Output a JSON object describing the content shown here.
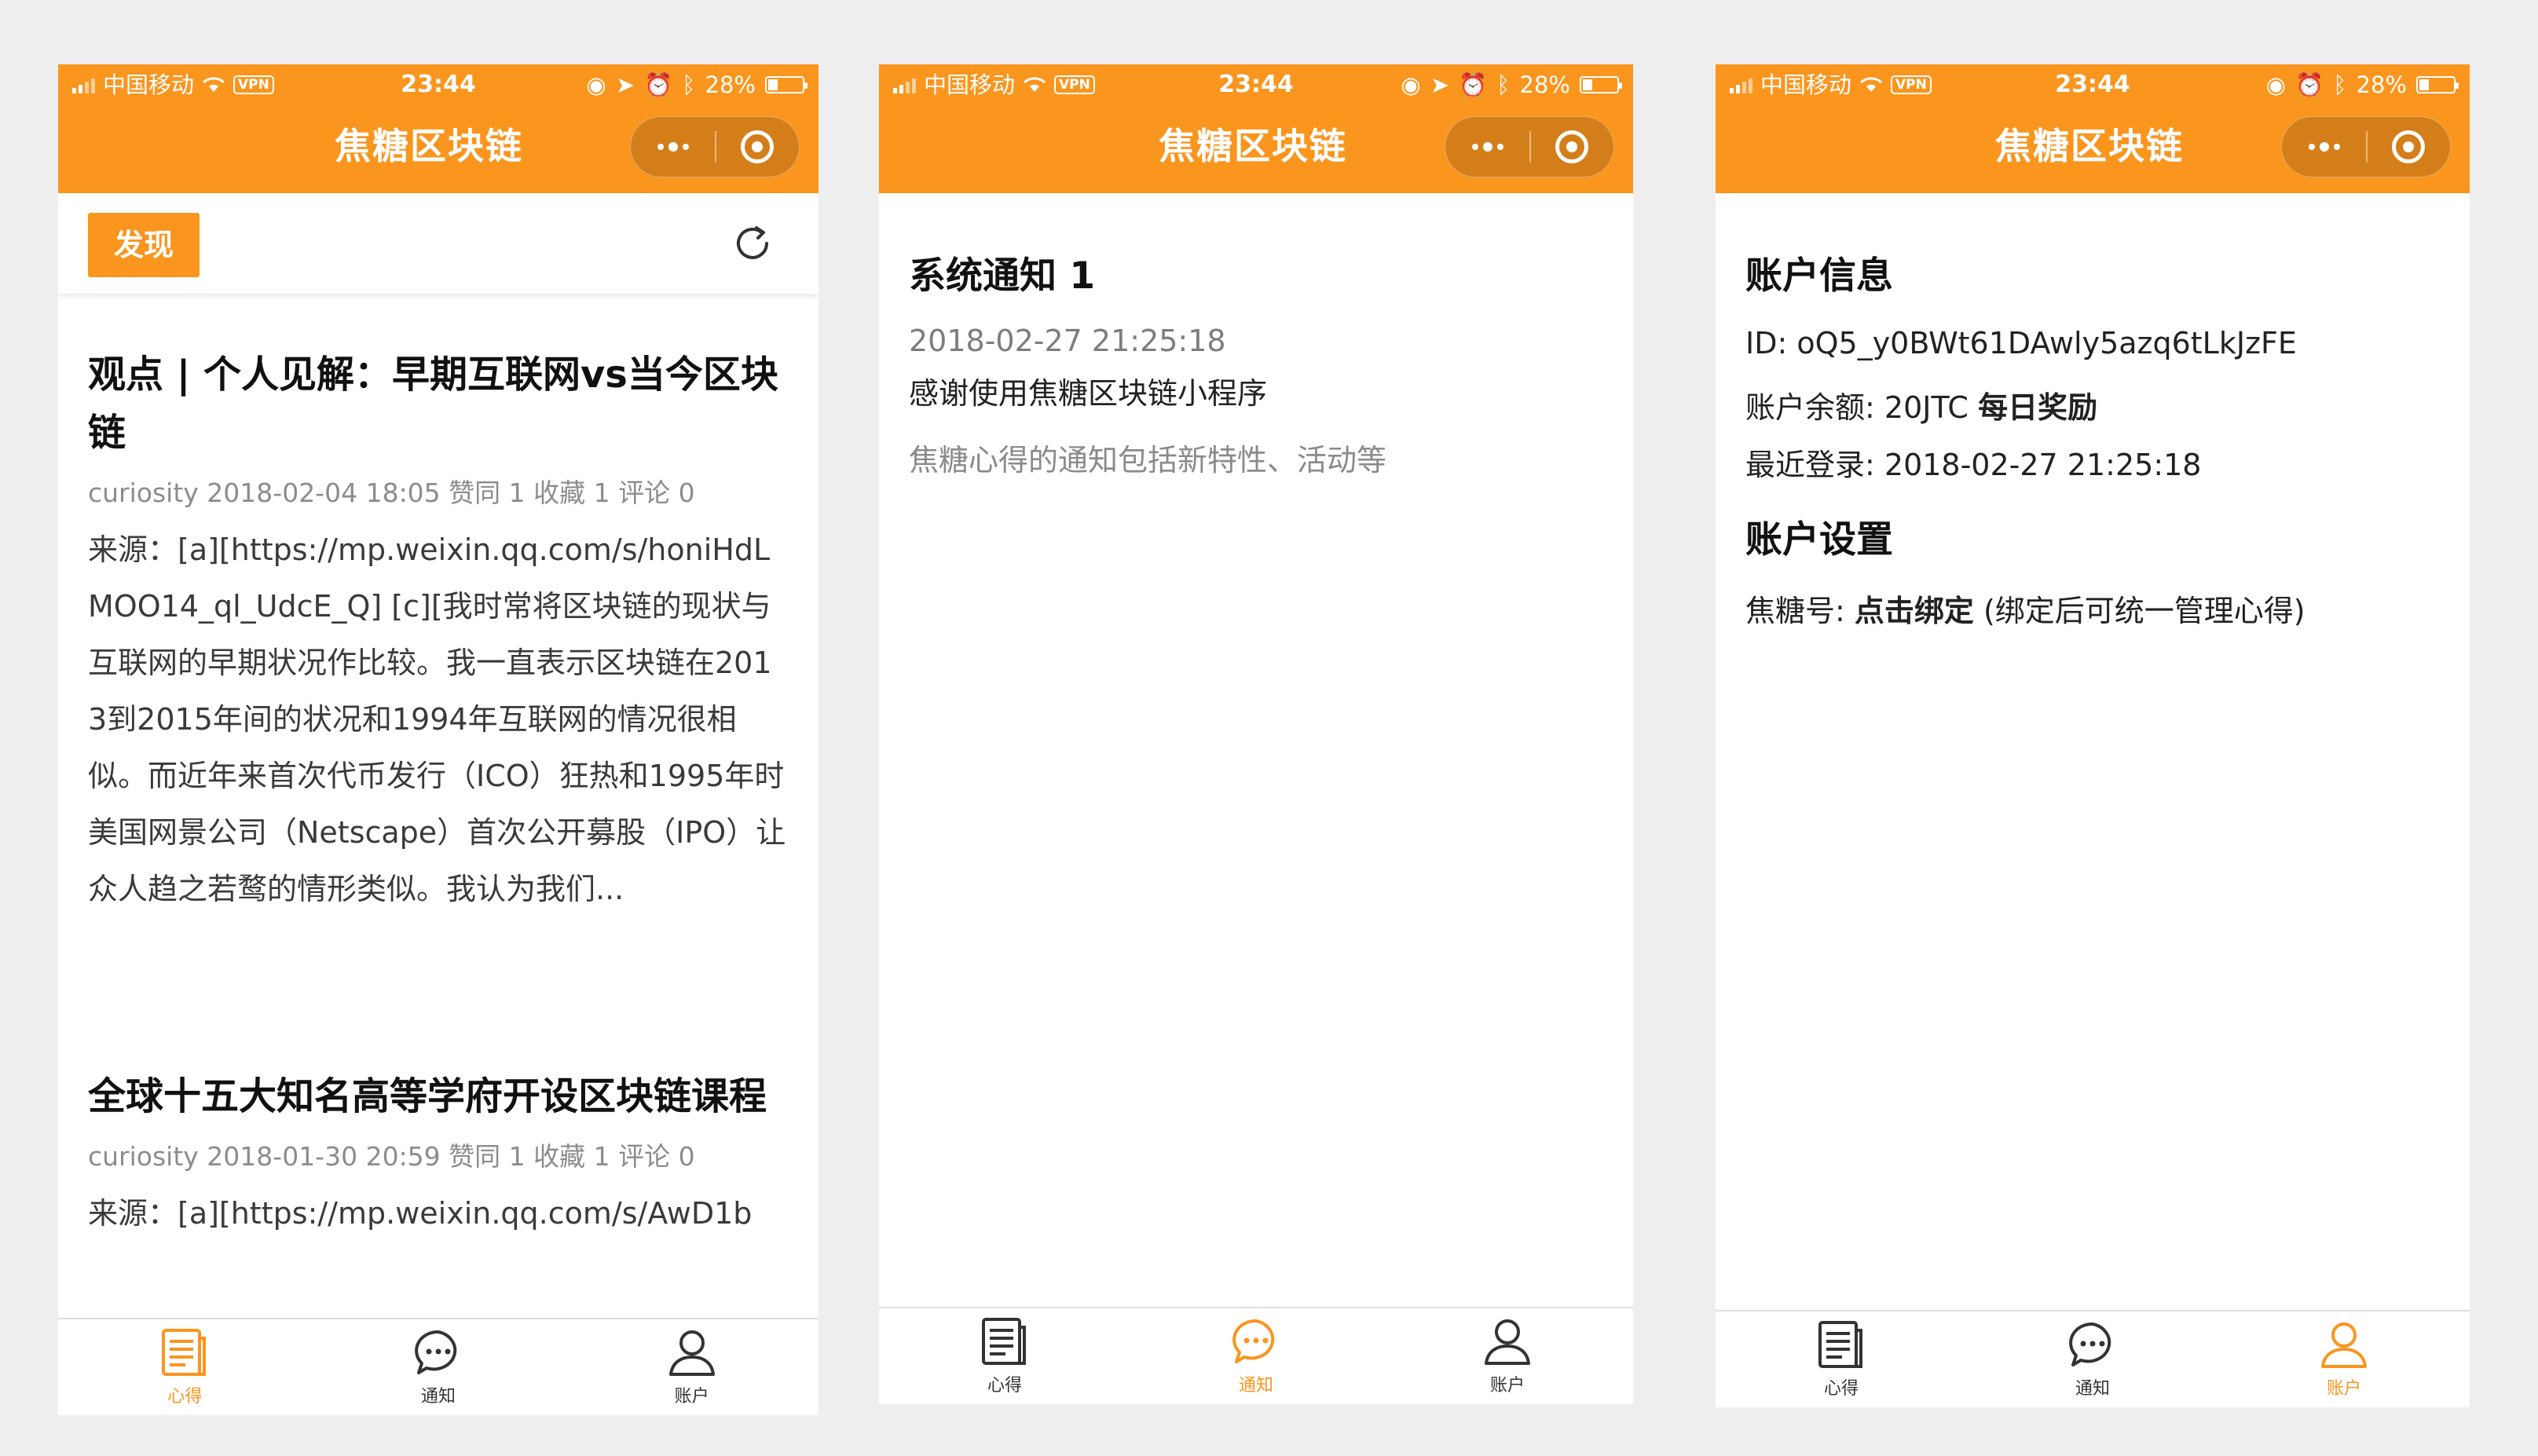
{
  "status": {
    "carrier": "中国移动",
    "vpn": "VPN",
    "time": "23:44",
    "battery": "28%"
  },
  "nav": {
    "title": "焦糖区块链"
  },
  "tabs": [
    {
      "label": "心得",
      "icon": "document-icon"
    },
    {
      "label": "通知",
      "icon": "chat-icon"
    },
    {
      "label": "账户",
      "icon": "user-icon"
    }
  ],
  "discover": {
    "button": "发现",
    "articles": [
      {
        "title": "观点 | 个人见解：早期互联网vs当今区块链",
        "meta": "curiosity 2018-02-04 18:05 赞同 1 收藏 1 评论 0",
        "body": "来源：[a][https://mp.weixin.qq.com/s/honiHdLMOO14_ql_UdcE_Q] [c][我时常将区块链的现状与互联网的早期状况作比较。我一直表示区块链在2013到2015年间的状况和1994年互联网的情况很相似。而近年来首次代币发行（ICO）狂热和1995年时美国网景公司（Netscape）首次公开募股（IPO）让众人趋之若鹜的情形类似。我认为我们..."
      },
      {
        "title": "全球十五大知名高等学府开设区块链课程",
        "meta": "curiosity 2018-01-30 20:59 赞同 1 收藏 1 评论 0",
        "body": "来源：[a][https://mp.weixin.qq.com/s/AwD1b"
      }
    ]
  },
  "notice": {
    "title": "系统通知 1",
    "date": "2018-02-27 21:25:18",
    "message": "感谢使用焦糖区块链小程序",
    "desc": "焦糖心得的通知包括新特性、活动等"
  },
  "account": {
    "info_title": "账户信息",
    "id_label": "ID: ",
    "id_value": "oQ5_y0BWt61DAwly5azq6tLkJzFE",
    "balance_label": "账户余额: ",
    "balance_value": "20JTC",
    "daily_reward": "每日奖励",
    "login_label": "最近登录: ",
    "login_value": "2018-02-27 21:25:18",
    "settings_title": "账户设置",
    "jt_label": "焦糖号: ",
    "bind_link": "点击绑定",
    "bind_hint": " (绑定后可统一管理心得)"
  },
  "colors": {
    "accent": "#fa951e",
    "text": "#333333",
    "muted": "#8c8c8c"
  }
}
